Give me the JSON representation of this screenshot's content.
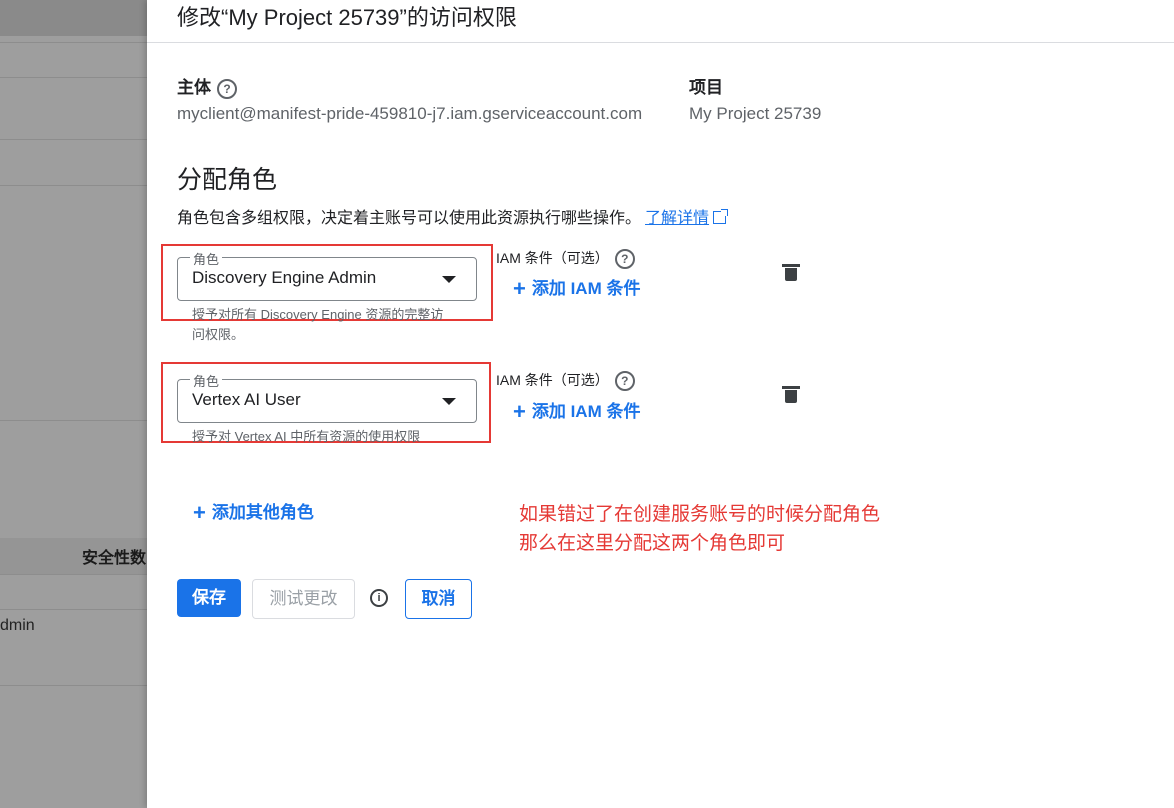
{
  "background": {
    "column_header": "安全性数",
    "cell_text": "dmin"
  },
  "panel": {
    "title": "修改“My Project 25739”的访问权限",
    "principal_label": "主体",
    "principal_value": "myclient@manifest-pride-459810-j7.iam.gserviceaccount.com",
    "project_label": "项目",
    "project_value": "My Project 25739",
    "section_title": "分配角色",
    "section_desc": "角色包含多组权限，决定着主账号可以使用此资源执行哪些操作。",
    "learn_more": "了解详情",
    "roles": [
      {
        "legend": "角色",
        "value": "Discovery Engine Admin",
        "hint": "授予对所有 Discovery Engine 资源的完整访问权限。",
        "iam_label": "IAM 条件（可选）",
        "add_iam": "添加 IAM 条件"
      },
      {
        "legend": "角色",
        "value": "Vertex AI User",
        "hint": "授予对 Vertex AI 中所有资源的使用权限",
        "iam_label": "IAM 条件（可选）",
        "add_iam": "添加 IAM 条件"
      }
    ],
    "add_other_role": "添加其他角色",
    "annotation_line1": "如果错过了在创建服务账号的时候分配角色",
    "annotation_line2": "那么在这里分配这两个角色即可",
    "buttons": {
      "save": "保存",
      "test": "测试更改",
      "cancel": "取消"
    },
    "help_glyph": "?",
    "info_glyph": "i",
    "plus_glyph": "+",
    "accent_color": "#1a73e8",
    "annotation_color": "#e53935"
  }
}
